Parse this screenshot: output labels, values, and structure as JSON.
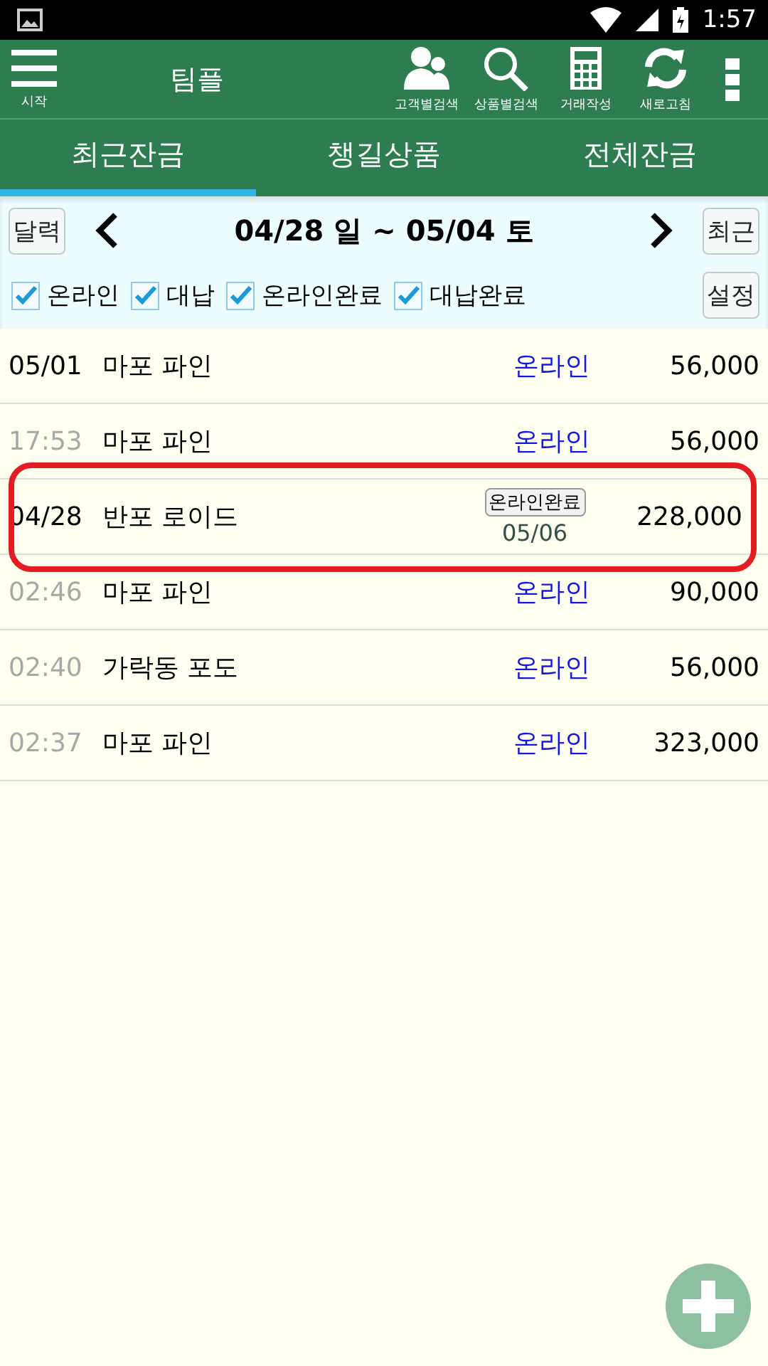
{
  "status_bar": {
    "time": "1:57"
  },
  "toolbar": {
    "menu_label": "시작",
    "title": "팀플",
    "actions": [
      {
        "kind": "customers",
        "label": "고객별검색"
      },
      {
        "kind": "search",
        "label": "상품별검색"
      },
      {
        "kind": "calculator",
        "label": "거래작성"
      },
      {
        "kind": "refresh",
        "label": "새로고침"
      }
    ]
  },
  "tabs": [
    {
      "label": "최근잔금",
      "selected": true
    },
    {
      "label": "챙길상품",
      "selected": false
    },
    {
      "label": "전체잔금",
      "selected": false
    }
  ],
  "date_nav": {
    "calendar_button": "달력",
    "range": "04/28 일 ~ 05/04 토",
    "recent_button": "최근"
  },
  "filters": [
    {
      "label": "온라인",
      "checked": true
    },
    {
      "label": "대납",
      "checked": true
    },
    {
      "label": "온라인완료",
      "checked": true
    },
    {
      "label": "대납완료",
      "checked": true
    }
  ],
  "settings_button": "설정",
  "rows": [
    {
      "kind": "date",
      "when": "05/01",
      "name": "마포 파인",
      "status": "온라인",
      "amount": "56,000",
      "highlighted": false
    },
    {
      "kind": "time",
      "when": "17:53",
      "name": "마포 파인",
      "status": "온라인",
      "amount": "56,000",
      "highlighted": false
    },
    {
      "kind": "date",
      "when": "04/28",
      "name": "반포 로이드",
      "status": "온라인완료",
      "done_date": "05/06",
      "amount": "228,000",
      "highlighted": true
    },
    {
      "kind": "time",
      "when": "02:46",
      "name": "마포 파인",
      "status": "온라인",
      "amount": "90,000",
      "highlighted": false
    },
    {
      "kind": "time",
      "when": "02:40",
      "name": "가락동 포도",
      "status": "온라인",
      "amount": "56,000",
      "highlighted": false
    },
    {
      "kind": "time",
      "when": "02:37",
      "name": "마포 파인",
      "status": "온라인",
      "amount": "323,000",
      "highlighted": false
    }
  ]
}
